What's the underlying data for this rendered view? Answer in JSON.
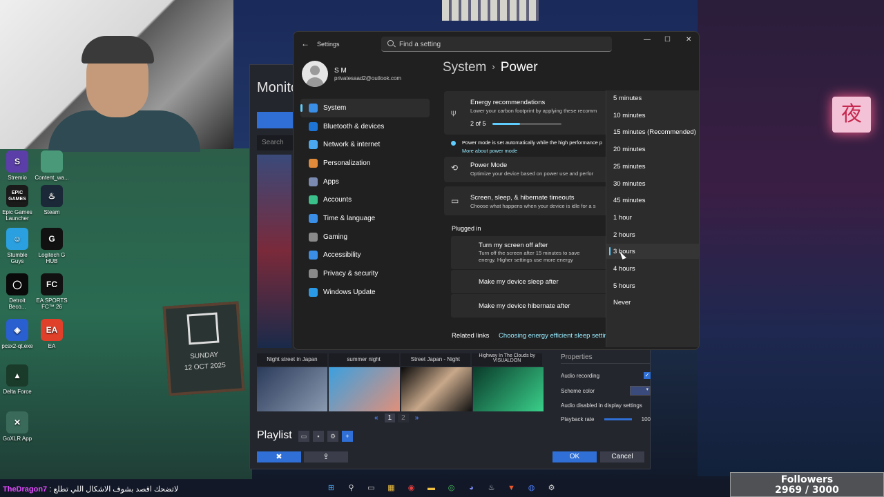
{
  "desktop": {
    "icons": [
      {
        "label": "Stremio",
        "glyph": "S",
        "color": "#5b3ea8"
      },
      {
        "label": "Content_wa...",
        "glyph": "",
        "color": "#4a9a7a"
      },
      {
        "label": "Epic Games Launcher",
        "glyph": "EPIC GAMES",
        "color": "#1a1a1a"
      },
      {
        "label": "Steam",
        "glyph": "♨",
        "color": "#1b2838"
      },
      {
        "label": "Stumble Guys",
        "glyph": "☺",
        "color": "#2aa0e0"
      },
      {
        "label": "Logitech G HUB",
        "glyph": "G",
        "color": "#111111"
      },
      {
        "label": "Detroit Beco...",
        "glyph": "◯",
        "color": "#0a0a0a"
      },
      {
        "label": "EA SPORTS FC™ 26",
        "glyph": "FC",
        "color": "#111111"
      },
      {
        "label": "pcsx2-qt.exe",
        "glyph": "◈",
        "color": "#2a5fd0"
      },
      {
        "label": "EA",
        "glyph": "EA",
        "color": "#e0402a"
      },
      {
        "label": "Delta Force",
        "glyph": "▲",
        "color": "#1a3a2a"
      },
      {
        "label": "GoXLR App",
        "glyph": "✕",
        "color": "#3a6a5a"
      }
    ],
    "chalkboard": {
      "day": "SUNDAY",
      "date": "12 OCT 2025"
    },
    "neon_sign": "夜"
  },
  "wallpaper_engine": {
    "title": "Monito",
    "search_placeholder": "Search",
    "thumb_labels": [
      "Night street in Japan",
      "summer night",
      "Street Japan - Night",
      "Highway In The Clouds by VISUALDON"
    ],
    "pages": [
      "1",
      "2"
    ],
    "playlist_label": "Playlist",
    "properties": {
      "heading": "Properties",
      "audio_recording": "Audio recording",
      "scheme_color": "Scheme color",
      "audio_disabled_note": "Audio disabled in display settings",
      "playback_rate_label": "Playback rate",
      "playback_rate_value": "100"
    },
    "ok_label": "OK",
    "cancel_label": "Cancel"
  },
  "settings": {
    "app_title": "Settings",
    "search_placeholder": "Find a setting",
    "window_controls": {
      "minimize": "—",
      "maximize": "☐",
      "close": "✕"
    },
    "profile": {
      "name": "S M",
      "email": "privatesaad2@outlook.com"
    },
    "nav": [
      {
        "label": "System",
        "icon": "monitor-icon",
        "color": "#3a8ee6",
        "active": true
      },
      {
        "label": "Bluetooth & devices",
        "icon": "bluetooth-icon",
        "color": "#1e74d4",
        "active": false
      },
      {
        "label": "Network & internet",
        "icon": "wifi-icon",
        "color": "#4aa8f0",
        "active": false
      },
      {
        "label": "Personalization",
        "icon": "brush-icon",
        "color": "#e08a3a",
        "active": false
      },
      {
        "label": "Apps",
        "icon": "apps-icon",
        "color": "#7a8ab0",
        "active": false
      },
      {
        "label": "Accounts",
        "icon": "person-icon",
        "color": "#3ac08a",
        "active": false
      },
      {
        "label": "Time & language",
        "icon": "globe-icon",
        "color": "#3a8ee6",
        "active": false
      },
      {
        "label": "Gaming",
        "icon": "gamepad-icon",
        "color": "#8a8a8a",
        "active": false
      },
      {
        "label": "Accessibility",
        "icon": "accessibility-icon",
        "color": "#3a8ee6",
        "active": false
      },
      {
        "label": "Privacy & security",
        "icon": "shield-icon",
        "color": "#8a8a8a",
        "active": false
      },
      {
        "label": "Windows Update",
        "icon": "update-icon",
        "color": "#2a9ae6",
        "active": false
      }
    ],
    "breadcrumb": {
      "parent": "System",
      "separator": "›",
      "current": "Power"
    },
    "energy": {
      "title": "Energy recommendations",
      "description": "Lower your carbon footprint by applying these recomm",
      "progress_text": "2 of 5",
      "progress_fraction": 0.4
    },
    "power_mode_info": {
      "text": "Power mode is set automatically while the high performance p",
      "link": "More about power mode"
    },
    "power_mode": {
      "title": "Power Mode",
      "description": "Optimize your device based on power use and perfor"
    },
    "timeouts": {
      "title": "Screen, sleep, & hibernate timeouts",
      "description": "Choose what happens when your device is idle for a s"
    },
    "plugged_in": {
      "heading": "Plugged in",
      "rows": [
        {
          "title": "Turn my screen off after",
          "description": "Turn off the screen after 15 minutes to save energy. Higher settings use more energy"
        },
        {
          "title": "Make my device sleep after",
          "description": ""
        },
        {
          "title": "Make my device hibernate after",
          "description": ""
        }
      ]
    },
    "related": {
      "label": "Related links",
      "link": "Choosing energy efficient sleep settings"
    },
    "dropdown": {
      "options": [
        "5 minutes",
        "10 minutes",
        "15 minutes (Recommended)",
        "20 minutes",
        "25 minutes",
        "30 minutes",
        "45 minutes",
        "1 hour",
        "2 hours",
        "3 hours",
        "4 hours",
        "5 hours",
        "Never"
      ],
      "highlighted": "3 hours"
    }
  },
  "overlay": {
    "chat_user": "TheDragon7",
    "chat_text": ": لاتضحك اقصد بشوف الاشكال اللي تطلع",
    "followers_label": "Followers",
    "followers_value": "2969 / 3000"
  },
  "taskbar": {
    "icons": [
      {
        "name": "start-icon",
        "glyph": "⊞",
        "color": "#4aa8f0"
      },
      {
        "name": "search-icon",
        "glyph": "⚲",
        "color": "#dddddd"
      },
      {
        "name": "task-view-icon",
        "glyph": "▭",
        "color": "#dddddd"
      },
      {
        "name": "widgets-icon",
        "glyph": "▦",
        "color": "#f0c040"
      },
      {
        "name": "app-icon",
        "glyph": "◉",
        "color": "#e04040"
      },
      {
        "name": "file-explorer-icon",
        "glyph": "▬",
        "color": "#f0c040"
      },
      {
        "name": "chrome-icon",
        "glyph": "◎",
        "color": "#4ac060"
      },
      {
        "name": "discord-icon",
        "glyph": "◕",
        "color": "#7a8af0"
      },
      {
        "name": "steam-icon",
        "glyph": "♨",
        "color": "#cfd8e0"
      },
      {
        "name": "brave-icon",
        "glyph": "▼",
        "color": "#f05a2a"
      },
      {
        "name": "screen-record-icon",
        "glyph": "◍",
        "color": "#4a7af0"
      },
      {
        "name": "settings-icon",
        "glyph": "⚙",
        "color": "#dddddd"
      }
    ]
  }
}
